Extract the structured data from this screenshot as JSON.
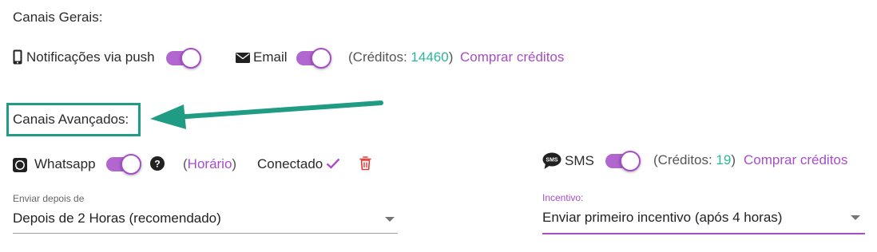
{
  "general": {
    "title": "Canais Gerais:",
    "push": {
      "icon": "mobile-phone-icon",
      "label": "Notificações via push",
      "enabled": true
    },
    "email": {
      "icon": "envelope-icon",
      "label": "Email",
      "enabled": true
    },
    "credits_open": "(Créditos: ",
    "credits_value": "14460",
    "credits_close": ")",
    "buy_credits": "Comprar créditos"
  },
  "advanced": {
    "title": "Canais Avançados:",
    "arrow_color": "#1f9c83",
    "whatsapp": {
      "icon": "whatsapp-icon",
      "label": "Whatsapp",
      "enabled": true,
      "help_icon": "question-circle-icon",
      "schedule_open": "(",
      "schedule_link": "Horário",
      "schedule_close": ")",
      "status": "Conectado",
      "status_icon": "checkmark-icon",
      "delete_icon": "trash-icon"
    },
    "sms": {
      "icon": "sms-bubble-icon",
      "label": "SMS",
      "enabled": true,
      "credits_open": "(Créditos: ",
      "credits_value": "19",
      "credits_close": ")",
      "buy_credits": "Comprar créditos"
    },
    "send_after": {
      "label": "Enviar depois de",
      "value": "Depois de 2 Horas (recomendado)"
    },
    "incentive": {
      "label": "Incentivo:",
      "value": "Enviar primeiro incentivo (após 4 horas)"
    }
  },
  "colors": {
    "accent": "#a74dc6",
    "credits": "#2bb59a",
    "highlight": "#1f9c83",
    "delete": "#e53935"
  }
}
